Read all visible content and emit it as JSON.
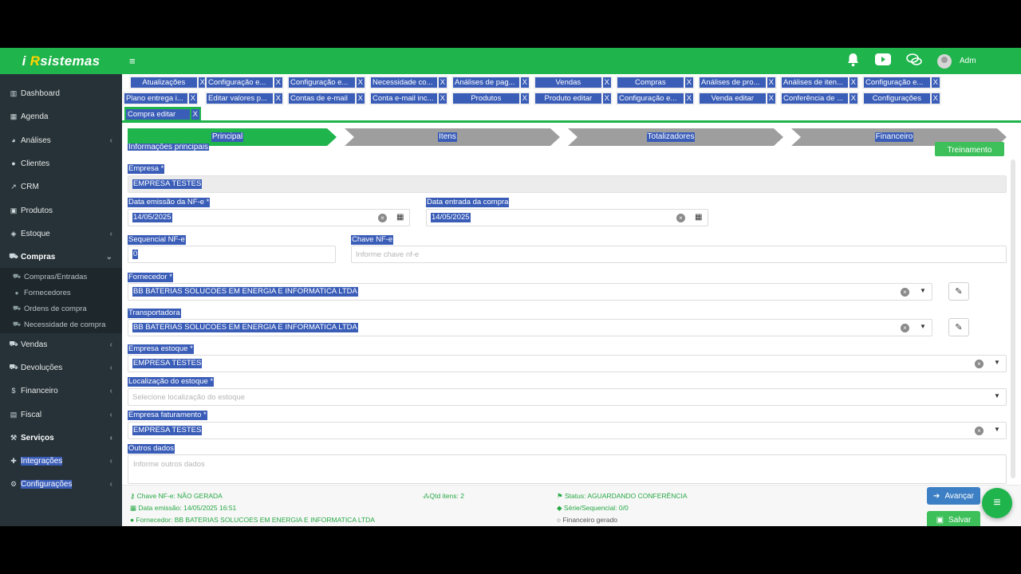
{
  "brand": {
    "i": "i",
    "r": "R",
    "rest": "sistemas"
  },
  "header": {
    "user": "Adm"
  },
  "sidebar": {
    "items": [
      {
        "label": "Dashboard",
        "icon": "chart-icon"
      },
      {
        "label": "Agenda",
        "icon": "calendar-icon"
      },
      {
        "label": "Análises",
        "icon": "analytics-icon"
      },
      {
        "label": "Clientes",
        "icon": "users-icon"
      },
      {
        "label": "CRM",
        "icon": "line-chart-icon"
      },
      {
        "label": "Produtos",
        "icon": "cubes-icon"
      },
      {
        "label": "Estoque",
        "icon": "layers-icon"
      },
      {
        "label": "Compras",
        "icon": "cart-icon"
      },
      {
        "label": "Vendas",
        "icon": "cart-icon"
      },
      {
        "label": "Devoluções",
        "icon": "cart-icon"
      },
      {
        "label": "Financeiro",
        "icon": "dollar-icon"
      },
      {
        "label": "Fiscal",
        "icon": "doc-icon"
      },
      {
        "label": "Serviços",
        "icon": "wrench-icon"
      },
      {
        "label": "Integrações",
        "icon": "puzzle-icon"
      },
      {
        "label": "Configurações",
        "icon": "cogs-icon"
      }
    ],
    "compras_sub": [
      "Compras/Entradas",
      "Fornecedores",
      "Ordens de compra",
      "Necessidade de compra"
    ]
  },
  "tabs": {
    "row1": [
      "Atualizações",
      "Configuração e...",
      "Configuração e...",
      "Necessidade co...",
      "Análises de pag...",
      "Vendas",
      "Compras",
      "Análises de pro...",
      "Análises de iten...",
      "Configuração e..."
    ],
    "row2": [
      "Plano entrega i...",
      "Editar valores p...",
      "Contas de e-mail",
      "Conta e-mail inc...",
      "Produtos",
      "Produto editar",
      "Configuração e...",
      "Venda editar",
      "Conferência de ...",
      "Configurações"
    ],
    "row3": [
      "Compra editar"
    ],
    "close": "X"
  },
  "wizard": [
    "Principal",
    "Itens",
    "Totalizadores",
    "Financeiro"
  ],
  "form": {
    "section_title": "Informações principais",
    "training_button": "Treinamento",
    "empresa_label": "Empresa *",
    "empresa_value": "EMPRESA TESTES",
    "data_emissao_label": "Data emissão da NF-e *",
    "data_emissao_value": "14/05/2025",
    "data_entrada_label": "Data entrada da compra",
    "data_entrada_value": "14/05/2025",
    "sequencial_label": "Sequencial NF-e",
    "sequencial_value": "0",
    "chave_label": "Chave NF-e",
    "chave_placeholder": "Informe chave nf-e",
    "fornecedor_label": "Fornecedor *",
    "fornecedor_value": "BB BATERIAS SOLUCOES EM ENERGIA E INFORMATICA LTDA",
    "transportadora_label": "Transportadora",
    "transportadora_value": "BB BATERIAS SOLUCOES EM ENERGIA E INFORMATICA LTDA",
    "empresa_estoque_label": "Empresa estoque *",
    "empresa_estoque_value": "EMPRESA TESTES",
    "localizacao_label": "Localização do estoque *",
    "localizacao_placeholder": "Selecione localização do estoque",
    "empresa_faturamento_label": "Empresa faturamento *",
    "empresa_faturamento_value": "EMPRESA TESTES",
    "outros_label": "Outros dados",
    "outros_placeholder": "Informe outros dados"
  },
  "footer": {
    "chave": "Chave NF-e: NÃO GERADA",
    "data_emissao": "Data emissão: 14/05/2025 16:51",
    "fornecedor": "Fornecedor: BB BATERIAS SOLUCOES EM ENERGIA E INFORMATICA LTDA",
    "qtd_itens": "Qtd itens: 2",
    "status": "Status: AGUARDANDO CONFERÊNCIA",
    "serie": "Série/Sequencial: 0/0",
    "financeiro": "Financeiro gerado",
    "avancar": "Avançar",
    "salvar": "Salvar"
  },
  "colors": {
    "brand_green": "#1fb44c",
    "sidebar": "#263238",
    "selection_blue": "#3a5db8",
    "wizard_gray": "#9e9e9e",
    "advance_blue": "#3d7fc4"
  }
}
